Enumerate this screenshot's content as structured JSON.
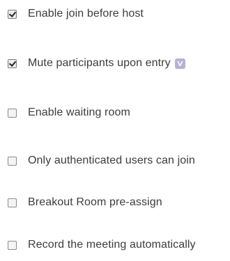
{
  "options": [
    {
      "label": "Enable join before host",
      "checked": true
    },
    {
      "label": "Mute participants upon entry",
      "checked": true,
      "badge": "info-badge-icon"
    },
    {
      "label": "Enable waiting room",
      "checked": false
    },
    {
      "label": "Only authenticated users can join",
      "checked": false
    },
    {
      "label": "Breakout Room pre-assign",
      "checked": false
    },
    {
      "label": "Record the meeting automatically",
      "checked": false
    }
  ],
  "colors": {
    "text": "#3c3c3c",
    "badge": "#b9b1d9"
  }
}
